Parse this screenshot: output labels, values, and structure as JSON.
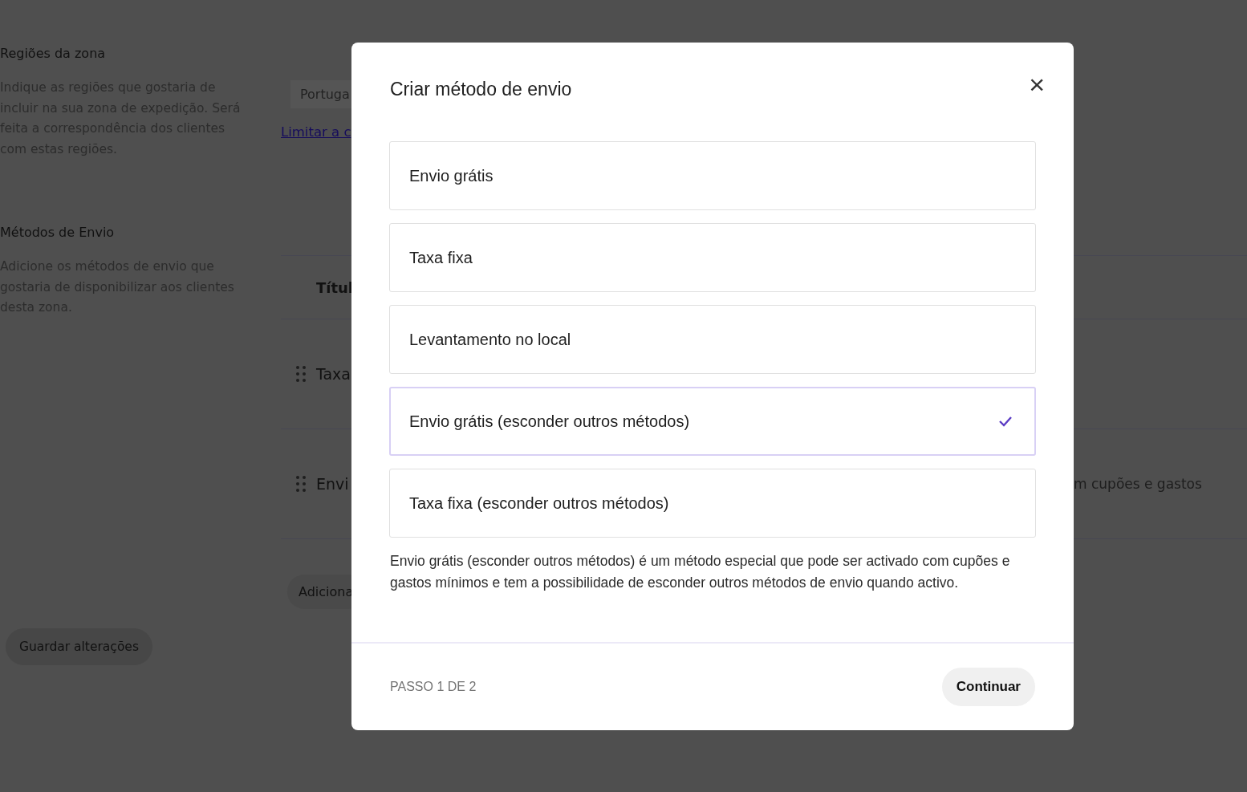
{
  "page": {
    "sections": [
      {
        "title": "Regiões da zona",
        "description": "Indique as regiões que gostaria de incluir na sua zona de expedição. Será feita a correspondência dos clientes com estas regiões."
      },
      {
        "title": "Métodos de Envio",
        "description": "Adicione os métodos de envio que gostaria de disponibilizar aos clientes desta zona."
      }
    ],
    "region_chip": "Portuga",
    "limit_link": "Limitar a c",
    "table": {
      "columns": [
        "Títul"
      ],
      "rows": [
        {
          "cells": [
            "Taxa"
          ]
        },
        {
          "cells": [
            "Envi",
            "m cupões e gastos"
          ]
        }
      ]
    },
    "add_button": "Adiciona",
    "save_button": "Guardar alterações"
  },
  "dialog": {
    "title": "Criar método de envio",
    "close": "×",
    "options": [
      {
        "label": "Envio grátis",
        "selected": false
      },
      {
        "label": "Taxa fixa",
        "selected": false
      },
      {
        "label": "Levantamento no local",
        "selected": false
      },
      {
        "label": "Envio grátis (esconder outros métodos)",
        "selected": true
      },
      {
        "label": "Taxa fixa (esconder outros métodos)",
        "selected": false
      }
    ],
    "description": "Envio grátis (esconder outros métodos) é um método especial que pode ser activado com cupões e gastos mínimos e tem a possibilidade de esconder outros métodos de envio quando activo.",
    "step": "PASSO 1 DE 2",
    "continue_button": "Continuar"
  }
}
